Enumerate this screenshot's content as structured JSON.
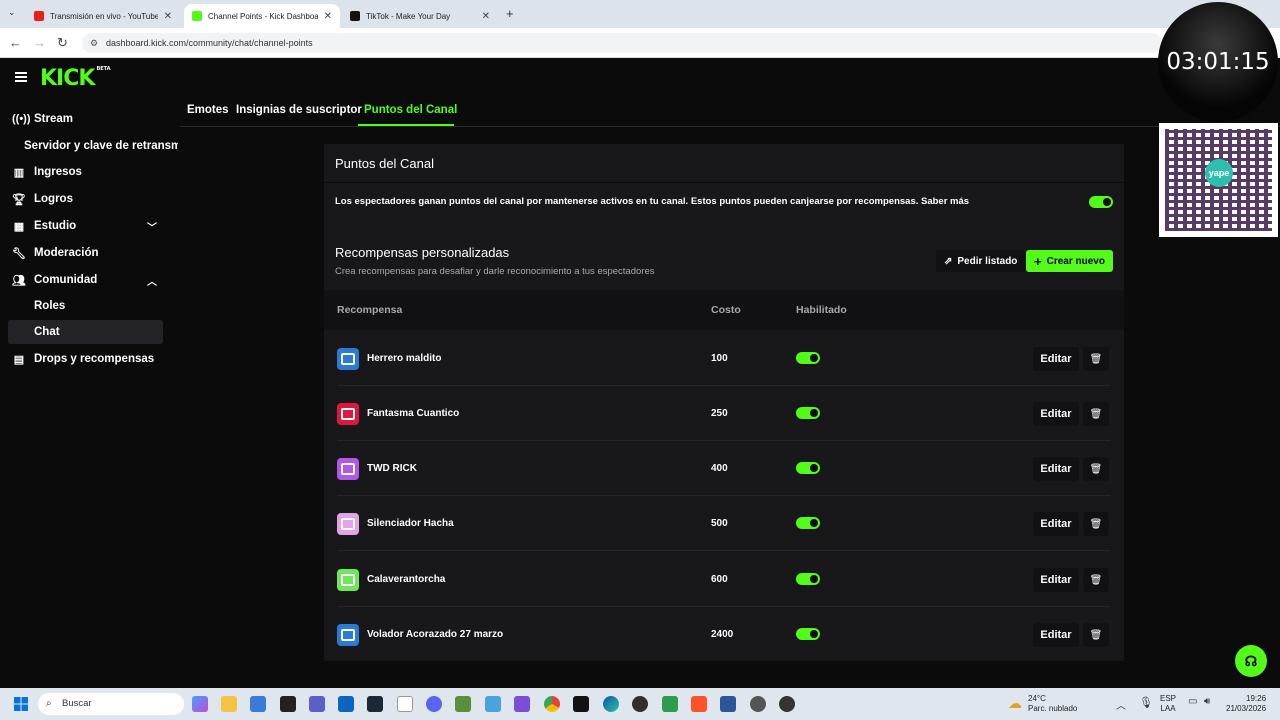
{
  "browser": {
    "tabs": [
      {
        "title": "Transmisión en vivo - YouTube",
        "favicon_color": "#e62117"
      },
      {
        "title": "Channel Points - Kick Dashboard",
        "favicon_color": "#53fc18"
      },
      {
        "title": "TikTok - Make Your Day",
        "favicon_color": "#111111"
      }
    ],
    "new_tab": "+",
    "url": "dashboard.kick.com/community/chat/channel-points"
  },
  "app": {
    "logo": "KICK",
    "logo_badge": "BETA",
    "accent_color": "#53fc18"
  },
  "sidebar": {
    "items": [
      {
        "label": "Stream",
        "icon": "broadcast-icon"
      },
      {
        "label": "Servidor y clave de retransm",
        "icon": ""
      },
      {
        "label": "Ingresos",
        "icon": "chart-icon"
      },
      {
        "label": "Logros",
        "icon": "trophy-icon"
      },
      {
        "label": "Estudio",
        "icon": "studio-icon"
      },
      {
        "label": "Moderación",
        "icon": "wrench-icon"
      },
      {
        "label": "Comunidad",
        "icon": "people-icon"
      },
      {
        "label": "Roles",
        "icon": ""
      },
      {
        "label": "Chat",
        "icon": ""
      },
      {
        "label": "Drops y recompensas",
        "icon": "gift-icon"
      }
    ]
  },
  "tabs": [
    {
      "label": "Emotes"
    },
    {
      "label": "Insignias de suscriptor"
    },
    {
      "label": "Puntos del Canal"
    }
  ],
  "channel_points": {
    "title": "Puntos del Canal",
    "description": "Los espectadores ganan puntos del canal por mantenerse activos en tu canal. Estos puntos pueden canjearse por recompensas. Saber más",
    "enabled": true
  },
  "rewards": {
    "title": "Recompensas personalizadas",
    "subtitle": "Crea recompensas para desafiar y darle reconocimiento a tus espectadores",
    "list_button": "Pedir listado",
    "create_button": "Crear nuevo",
    "columns": {
      "reward": "Recompensa",
      "cost": "Costo",
      "enabled": "Habilitado"
    },
    "edit_label": "Editar",
    "items": [
      {
        "name": "Herrero maldito",
        "cost": "100",
        "color": "#2a7ad6",
        "enabled": true
      },
      {
        "name": "Fantasma Cuantico",
        "cost": "250",
        "color": "#e0173d",
        "enabled": true
      },
      {
        "name": "TWD RICK",
        "cost": "400",
        "color": "#b158e8",
        "enabled": true
      },
      {
        "name": "Silenciador Hacha",
        "cost": "500",
        "color": "#e2a3e8",
        "enabled": true
      },
      {
        "name": "Calaverantorcha",
        "cost": "600",
        "color": "#6ee85a",
        "enabled": true
      },
      {
        "name": "Volador Acorazado 27 marzo",
        "cost": "2400",
        "color": "#2a7ad6",
        "enabled": true
      }
    ]
  },
  "overlay": {
    "timer": "03:01:15",
    "qr_brand": "yape"
  },
  "taskbar": {
    "search_placeholder": "Buscar",
    "weather_temp": "24°C",
    "weather_desc": "Parc. nublado",
    "lang_top": "ESP",
    "lang_bottom": "LAA",
    "time": "19:26",
    "date": "21/03/2026"
  }
}
